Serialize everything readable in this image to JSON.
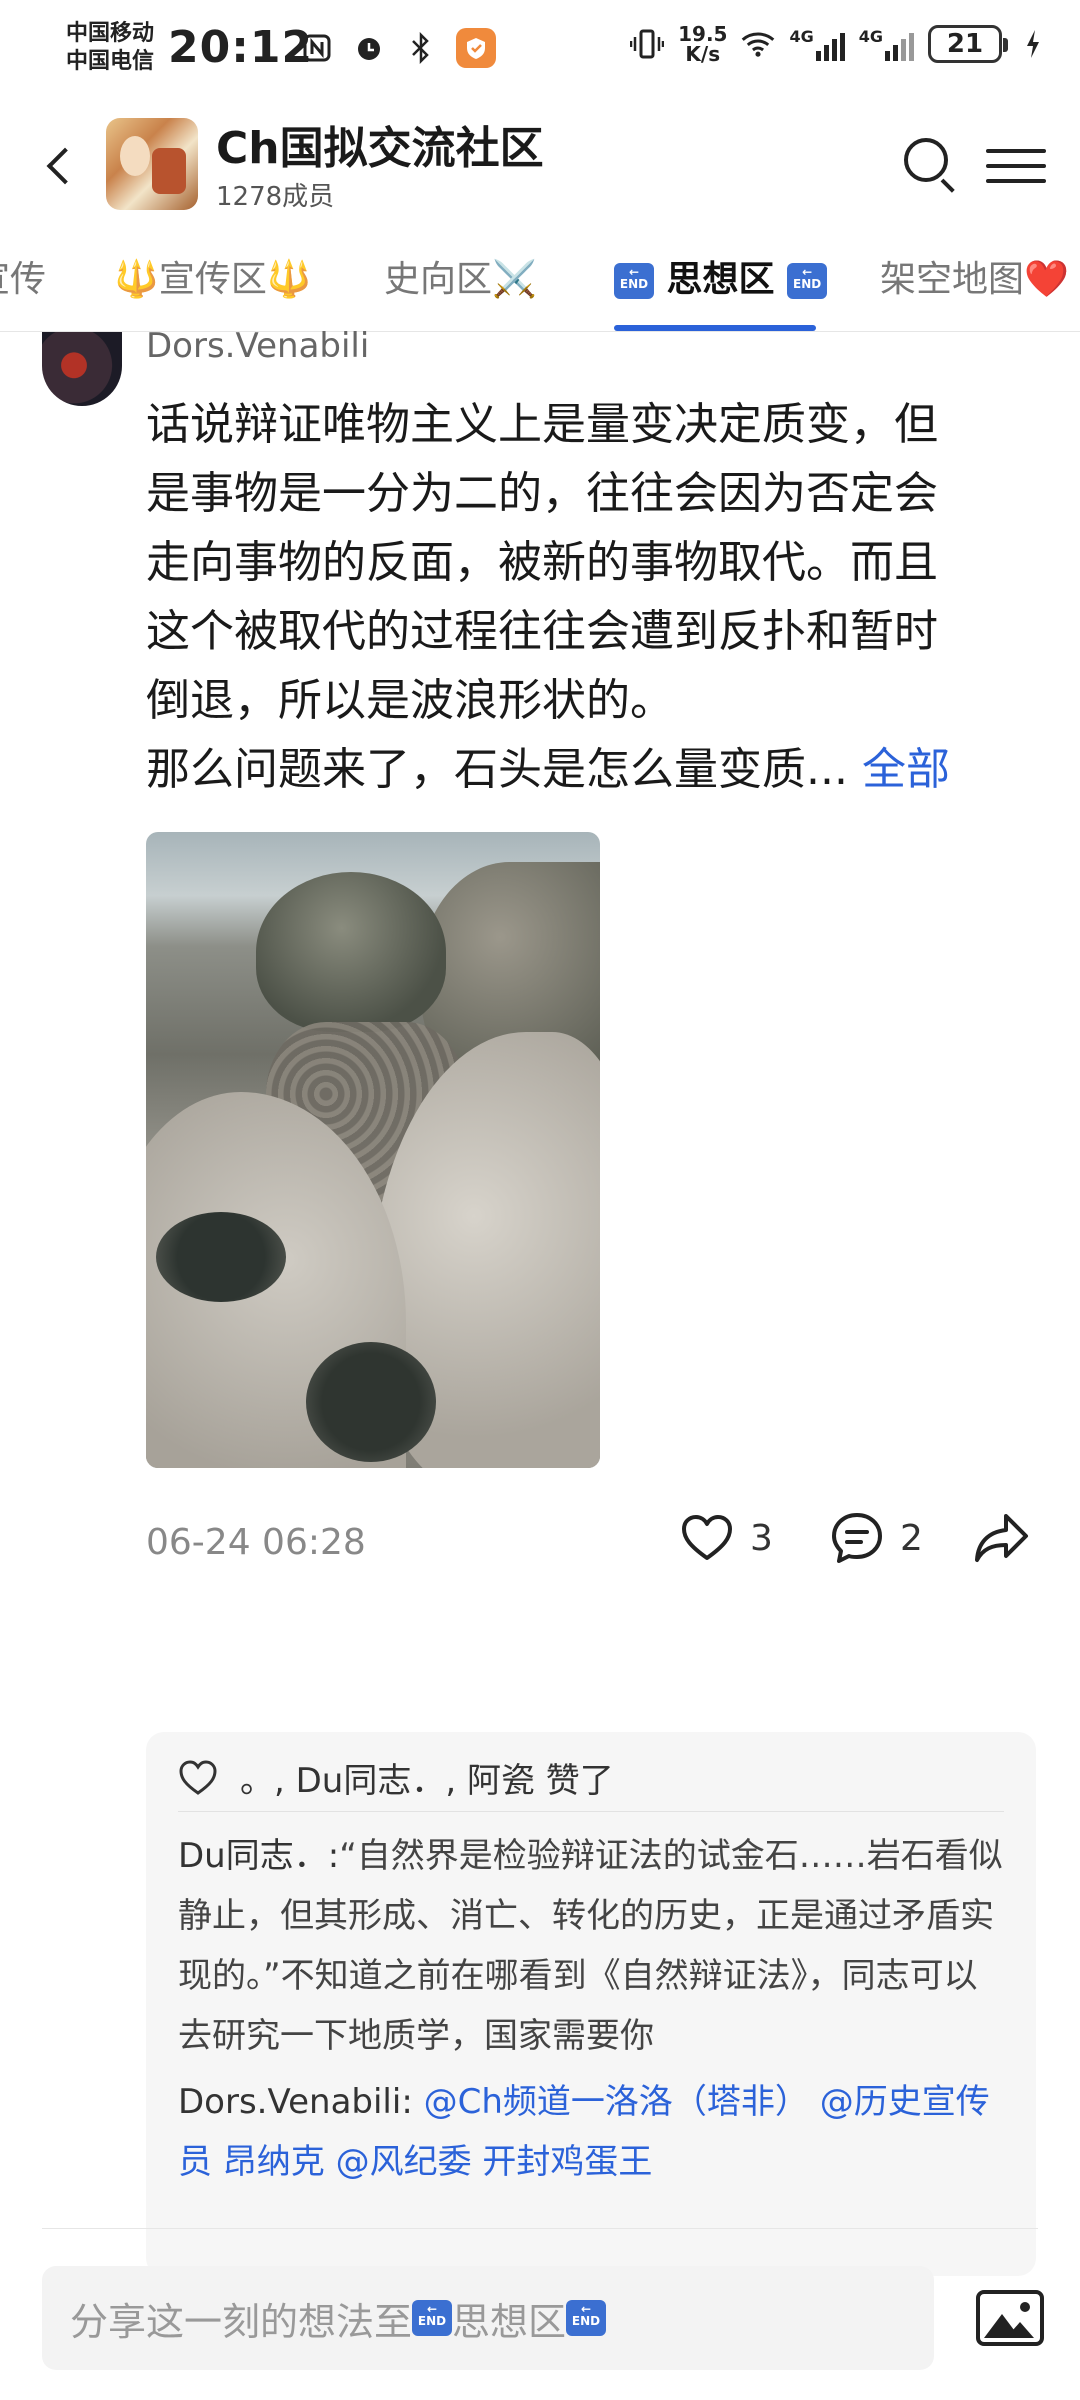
{
  "status_bar": {
    "carrier_1": "中国移动",
    "carrier_2": "中国电信",
    "time": "20:12",
    "net_speed_value": "19.5",
    "net_speed_unit": "K/s",
    "network_1": "4G",
    "network_2": "4G",
    "battery": "21",
    "icons": [
      "nfc-icon",
      "alarm-icon",
      "bluetooth-icon",
      "shield-app-icon",
      "vibrate-icon",
      "wifi-icon",
      "signal-icon",
      "charging-icon"
    ]
  },
  "header": {
    "title": "Ch国拟交流社区",
    "members": "1278成员"
  },
  "tabs": [
    {
      "label": "宣传"
    },
    {
      "label": "🔱宣传区🔱"
    },
    {
      "label": "史向区⚔️"
    },
    {
      "label": "思想区",
      "active": true
    },
    {
      "label": "架空地图❤️"
    }
  ],
  "post": {
    "author": "Dors.Venabili",
    "text_lines": [
      "话说辩证唯物主义上是量变决定质变，但",
      "是事物是一分为二的，往往会因为否定会",
      "走向事物的反面，被新的事物取代。而且",
      "这个被取代的过程往往会遭到反扑和暂时",
      "倒退，所以是波浪形状的。",
      "那么问题来了，石头是怎么量变质..."
    ],
    "more_label": "全部",
    "time": "06-24 06:28",
    "like_count": "3",
    "comment_count": "2"
  },
  "comments_box": {
    "likes_text": "。, Du同志．, 阿瓷 赞了",
    "comments": [
      {
        "author": "Du同志．:",
        "text": "“自然界是检验辩证法的试金石……岩石看似静止，但其形成、消亡、转化的历史，正是通过矛盾实现的。”不知道之前在哪看到《自然辩证法》，同志可以去研究一下地质学，国家需要你"
      },
      {
        "author": "Dors.Venabili:",
        "mentions": [
          "@Ch频道一洛洛（塔非）",
          "@历史宣传员 昂纳克",
          "@风纪委 开封鸡蛋王"
        ]
      }
    ]
  },
  "composer": {
    "placeholder_prefix": "分享这一刻的想法至",
    "placeholder_target": "思想区"
  },
  "colors": {
    "accent": "#2b62d9",
    "end_badge": "#3b6fd1"
  }
}
